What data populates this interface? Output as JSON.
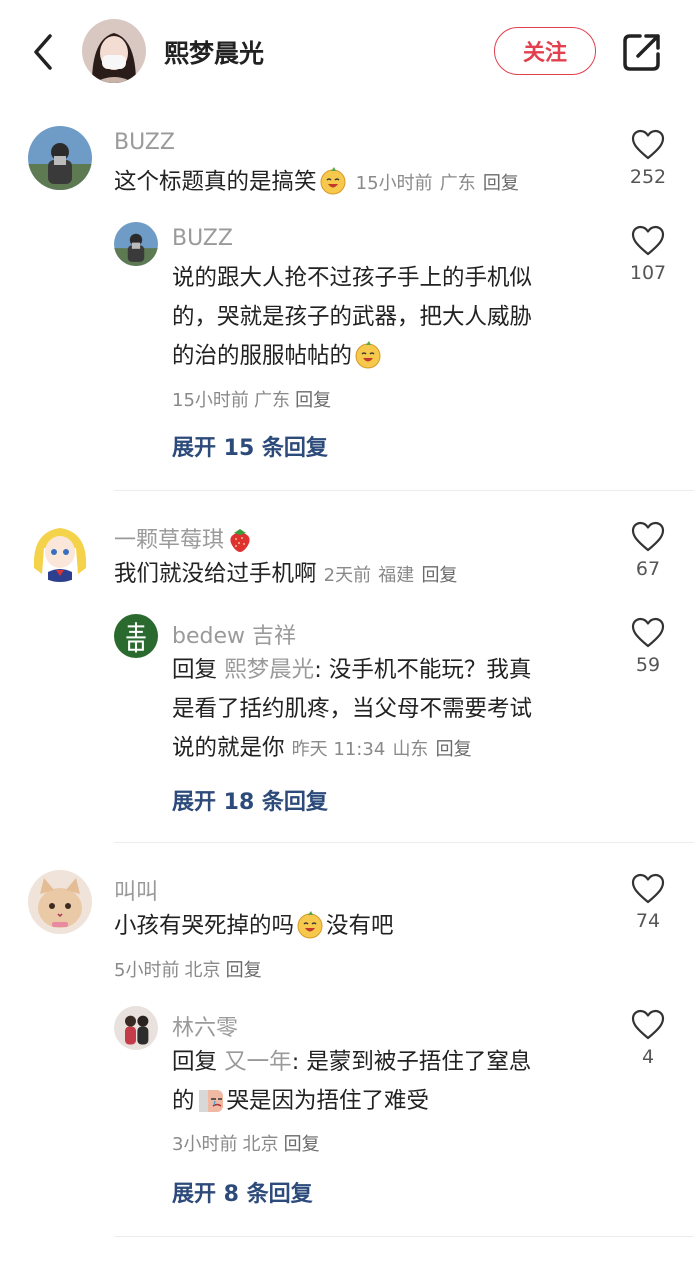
{
  "header": {
    "title": "熙梦晨光",
    "follow_label": "关注"
  },
  "threads": [
    {
      "comment": {
        "username": "BUZZ",
        "text": "这个标题真的是搞笑",
        "time": "15小时前",
        "location": "广东",
        "reply_label": "回复",
        "likes": "252"
      },
      "reply": {
        "username": "BUZZ",
        "text_line1": "说的跟大人抢不过孩子手上的手机似",
        "text_line2": "的，哭就是孩子的武器，把大人威胁",
        "text_line3": "的治的服服帖帖的",
        "time": "15小时前",
        "location": "广东",
        "reply_label": "回复",
        "likes": "107"
      },
      "expand_label": "展开 15 条回复"
    },
    {
      "comment": {
        "username": "一颗草莓琪",
        "text": "我们就没给过手机啊",
        "time": "2天前",
        "location": "福建",
        "reply_label": "回复",
        "likes": "67"
      },
      "reply": {
        "username": "bedew 吉祥",
        "reply_prefix": "回复",
        "reply_to": "熙梦晨光",
        "text_line1": ": 没手机不能玩？我真",
        "text_line2": "是看了括约肌疼，当父母不需要考试",
        "text_line3": "说的就是你",
        "time": "昨天 11:34",
        "location": "山东",
        "reply_label": "回复",
        "likes": "59"
      },
      "expand_label": "展开 18 条回复"
    },
    {
      "comment": {
        "username": "叫叫",
        "text_before": "小孩有哭死掉的吗",
        "text_after": "没有吧",
        "time": "5小时前",
        "location": "北京",
        "reply_label": "回复",
        "likes": "74"
      },
      "reply": {
        "username": "林六零",
        "reply_prefix": "回复",
        "reply_to": "又一年",
        "text_line1": ": 是蒙到被子捂住了窒息",
        "text_line2a": "的",
        "text_line2b": "哭是因为捂住了难受",
        "time": "3小时前",
        "location": "北京",
        "reply_label": "回复",
        "likes": "4"
      },
      "expand_label": "展开 8 条回复"
    }
  ],
  "colors": {
    "accent": "#e2404f",
    "link": "#2c4a7a",
    "muted": "#9a9a9a"
  }
}
